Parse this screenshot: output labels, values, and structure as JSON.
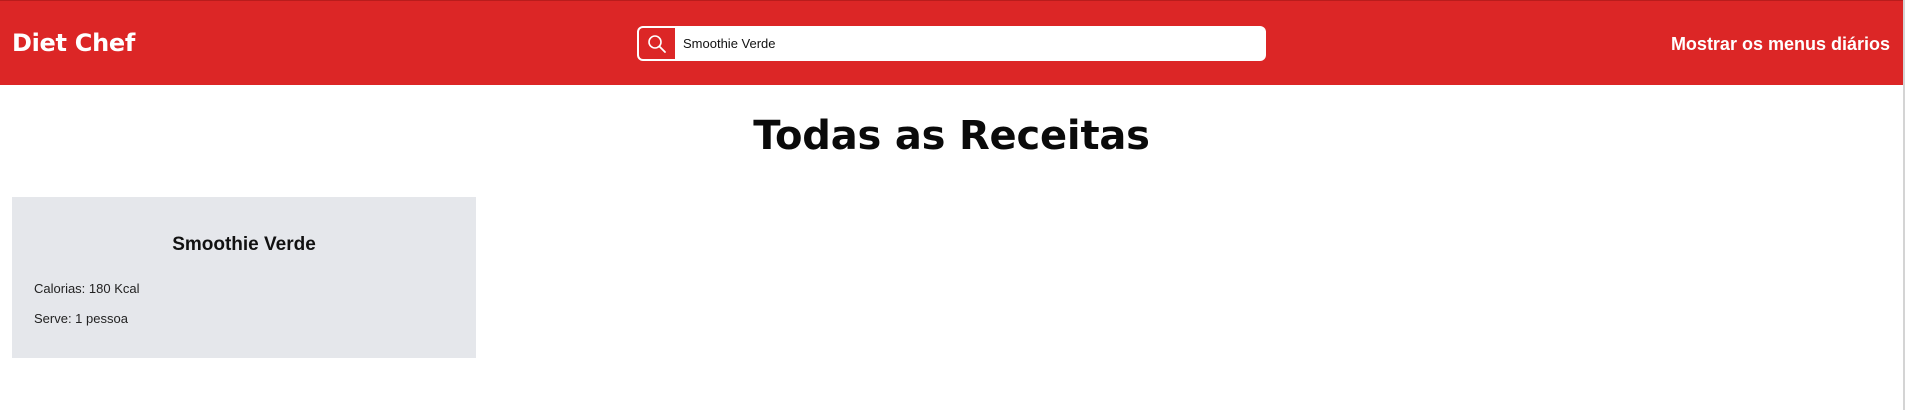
{
  "header": {
    "brand": "Diet Chef",
    "search": {
      "value": "Smoothie Verde",
      "icon": "search-icon"
    },
    "menus_link": "Mostrar os menus diários"
  },
  "main": {
    "title": "Todas as Receitas",
    "recipes": [
      {
        "title": "Smoothie Verde",
        "calories": "Calorias: 180 Kcal",
        "serves": "Serve: 1 pessoa"
      }
    ]
  },
  "colors": {
    "accent": "#dc2626",
    "card_bg": "#e5e7eb"
  }
}
